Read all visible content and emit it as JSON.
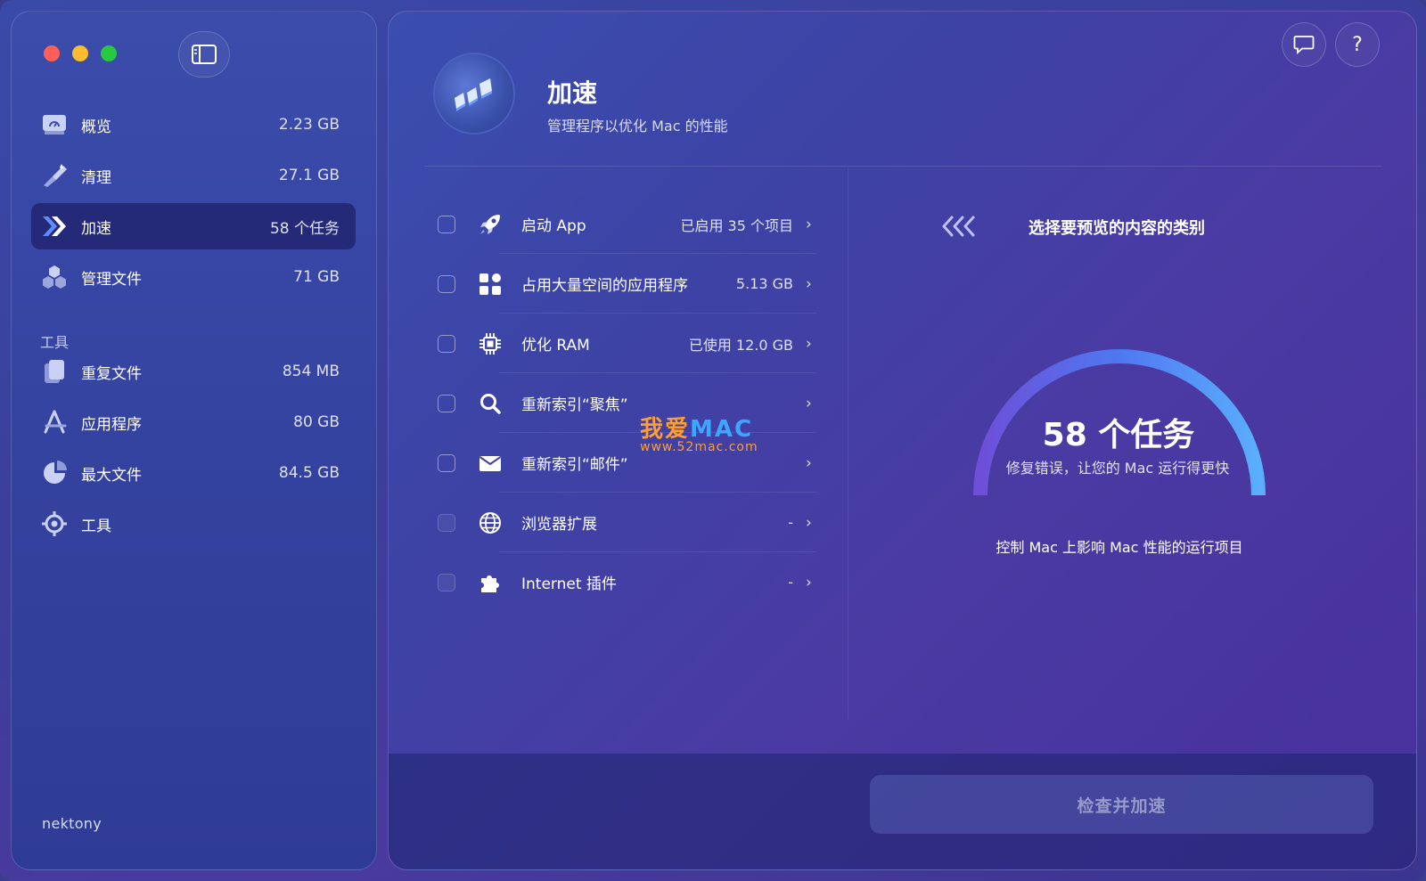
{
  "sidebar": {
    "items": [
      {
        "label": "概览",
        "value": "2.23 GB",
        "icon": "overview-icon"
      },
      {
        "label": "清理",
        "value": "27.1 GB",
        "icon": "cleanup-icon"
      },
      {
        "label": "加速",
        "value": "58 个任务",
        "icon": "speedup-icon"
      },
      {
        "label": "管理文件",
        "value": "71 GB",
        "icon": "manage-files-icon"
      }
    ],
    "tools_header": "工具",
    "tools": [
      {
        "label": "重复文件",
        "value": "854 MB",
        "icon": "duplicate-files-icon"
      },
      {
        "label": "应用程序",
        "value": "80 GB",
        "icon": "applications-icon"
      },
      {
        "label": "最大文件",
        "value": "84.5 GB",
        "icon": "largest-files-icon"
      },
      {
        "label": "工具",
        "value": "",
        "icon": "tools-icon"
      }
    ],
    "brand": "nektony"
  },
  "header": {
    "title": "加速",
    "subtitle": "管理程序以优化 Mac 的性能",
    "help_label": "?"
  },
  "tasks": [
    {
      "label": "启动 App",
      "value": "已启用 35 个项目",
      "icon": "rocket-icon",
      "enabled": true
    },
    {
      "label": "占用大量空间的应用程序",
      "value": "5.13 GB",
      "icon": "apps-grid-icon",
      "enabled": true
    },
    {
      "label": "优化 RAM",
      "value": "已使用 12.0 GB",
      "icon": "chip-icon",
      "enabled": true
    },
    {
      "label": "重新索引“聚焦”",
      "value": "",
      "icon": "magnifier-icon",
      "enabled": true
    },
    {
      "label": "重新索引“邮件”",
      "value": "",
      "icon": "mail-icon",
      "enabled": true
    },
    {
      "label": "浏览器扩展",
      "value": "-",
      "icon": "globe-icon",
      "enabled": false
    },
    {
      "label": "Internet 插件",
      "value": "-",
      "icon": "puzzle-icon",
      "enabled": false
    }
  ],
  "chevron": "›",
  "preview": {
    "title": "选择要预览的内容的类别",
    "count": "58 个任务",
    "description": "修复错误，让您的 Mac 运行得更快",
    "caption": "控制 Mac 上影响 Mac 性能的运行项目"
  },
  "action_button": "检查并加速",
  "watermark": {
    "big_a": "我爱",
    "big_b": "MAC",
    "url": "www.52mac.com"
  },
  "colors": {
    "accent": "#3da6ff",
    "active_item": "#252a78"
  }
}
